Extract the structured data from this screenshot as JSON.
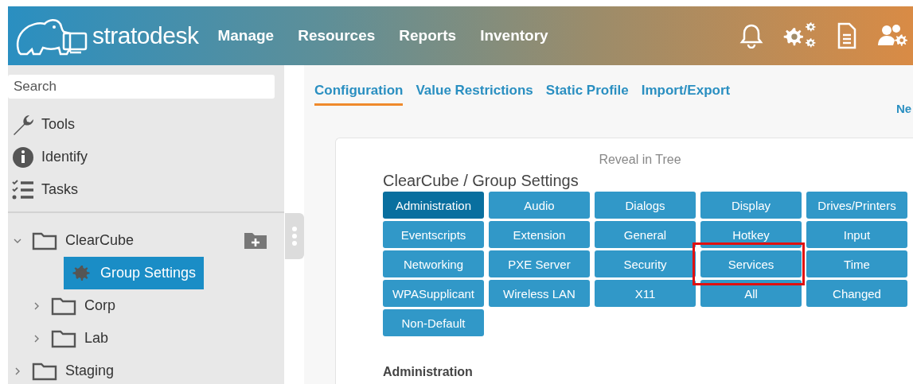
{
  "header": {
    "logo_text": "stratodesk",
    "nav": [
      "Manage",
      "Resources",
      "Reports",
      "Inventory"
    ]
  },
  "sidebar": {
    "search": {
      "placeholder": "Search"
    },
    "tools": [
      {
        "label": "Tools",
        "kind": "wrench"
      },
      {
        "label": "Identify",
        "kind": "info"
      },
      {
        "label": "Tasks",
        "kind": "tasks"
      }
    ],
    "tree": [
      {
        "label": "ClearCube",
        "kind": "folder",
        "expanded": true,
        "selected": false,
        "add_icon": true,
        "children": [
          {
            "label": "Group Settings",
            "kind": "settings",
            "selected": true
          },
          {
            "label": "Corp",
            "kind": "folder",
            "expanded": false,
            "selected": false
          },
          {
            "label": "Lab",
            "kind": "folder",
            "expanded": false,
            "selected": false
          }
        ]
      },
      {
        "label": "Staging",
        "kind": "folder",
        "expanded": false,
        "selected": false
      }
    ]
  },
  "tabs": [
    {
      "label": "Configuration",
      "selected": true
    },
    {
      "label": "Value Restrictions",
      "selected": false
    },
    {
      "label": "Static Profile",
      "selected": false
    },
    {
      "label": "Import/Export",
      "selected": false
    }
  ],
  "cut_link": "Ne",
  "panel": {
    "reveal": "Reveal in Tree",
    "title": "ClearCube / Group Settings",
    "buttons": [
      {
        "label": "Administration",
        "selected": true,
        "highlighted": false
      },
      {
        "label": "Audio",
        "selected": false,
        "highlighted": false
      },
      {
        "label": "Dialogs",
        "selected": false,
        "highlighted": false
      },
      {
        "label": "Display",
        "selected": false,
        "highlighted": false
      },
      {
        "label": "Drives/Printers",
        "selected": false,
        "highlighted": false
      },
      {
        "label": "Eventscripts",
        "selected": false,
        "highlighted": false
      },
      {
        "label": "Extension",
        "selected": false,
        "highlighted": false
      },
      {
        "label": "General",
        "selected": false,
        "highlighted": false
      },
      {
        "label": "Hotkey",
        "selected": false,
        "highlighted": false
      },
      {
        "label": "Input",
        "selected": false,
        "highlighted": false
      },
      {
        "label": "Networking",
        "selected": false,
        "highlighted": false
      },
      {
        "label": "PXE Server",
        "selected": false,
        "highlighted": false
      },
      {
        "label": "Security",
        "selected": false,
        "highlighted": false
      },
      {
        "label": "Services",
        "selected": false,
        "highlighted": true
      },
      {
        "label": "Time",
        "selected": false,
        "highlighted": false
      },
      {
        "label": "WPASupplicant",
        "selected": false,
        "highlighted": false
      },
      {
        "label": "Wireless LAN",
        "selected": false,
        "highlighted": false
      },
      {
        "label": "X11",
        "selected": false,
        "highlighted": false
      },
      {
        "label": "All",
        "selected": false,
        "highlighted": false
      },
      {
        "label": "Changed",
        "selected": false,
        "highlighted": false
      },
      {
        "label": "Non-Default",
        "selected": false,
        "highlighted": false
      }
    ],
    "section": "Administration"
  }
}
